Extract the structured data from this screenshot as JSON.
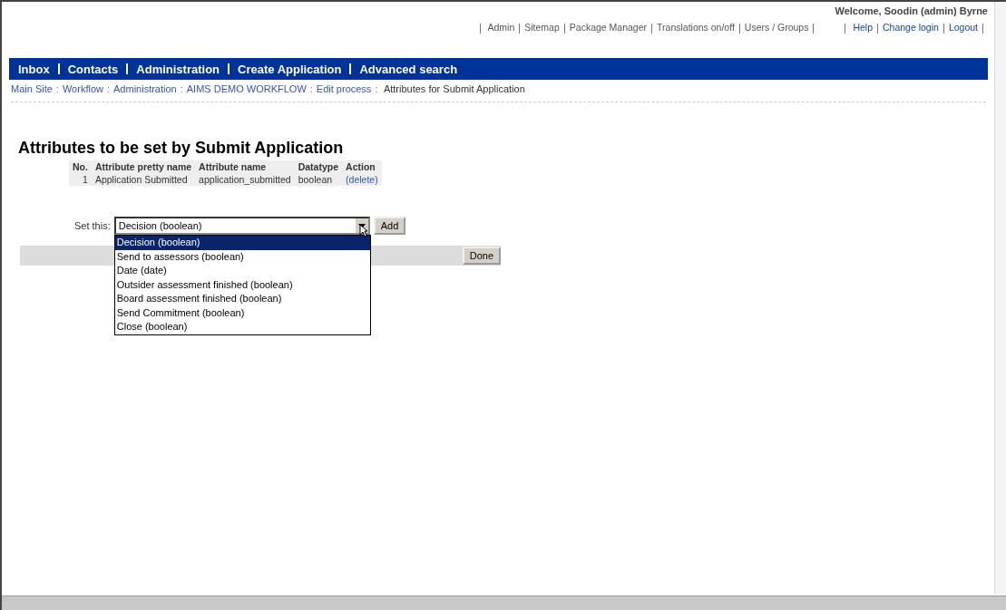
{
  "header": {
    "welcome": "Welcome, Soodin (admin) Byrne",
    "admin_links": [
      "Admin",
      "Sitemap",
      "Package Manager",
      "Translations on/off",
      "Users / Groups"
    ],
    "user_links": [
      "Help",
      "Change login",
      "Logout"
    ]
  },
  "nav": [
    "Inbox",
    "Contacts",
    "Administration",
    "Create Application",
    "Advanced search"
  ],
  "breadcrumb": {
    "links": [
      "Main Site",
      "Workflow",
      "Administration",
      "AIMS DEMO WORKFLOW",
      "Edit process"
    ],
    "current": "Attributes for Submit Application",
    "separator": ":"
  },
  "heading": "Attributes to be set by Submit Application",
  "table": {
    "columns": [
      "No.",
      "Attribute pretty name",
      "Attribute name",
      "Datatype",
      "Action"
    ],
    "rows": [
      {
        "no": "1",
        "pretty_name": "Application Submitted",
        "name": "application_submitted",
        "datatype": "boolean",
        "action": "(delete)"
      }
    ]
  },
  "set_this": {
    "label": "Set this:",
    "value": "Decision (boolean)",
    "add": "Add",
    "options": [
      {
        "label": "Decision (boolean)",
        "selected": true
      },
      {
        "label": "Send to assessors (boolean)",
        "selected": false
      },
      {
        "label": "Date (date)",
        "selected": false
      },
      {
        "label": "Outsider assessment finished (boolean)",
        "selected": false
      },
      {
        "label": "Board assessment finished (boolean)",
        "selected": false
      },
      {
        "label": "Send Commitment (boolean)",
        "selected": false
      },
      {
        "label": "Close (boolean)",
        "selected": false
      }
    ]
  },
  "done": "Done"
}
